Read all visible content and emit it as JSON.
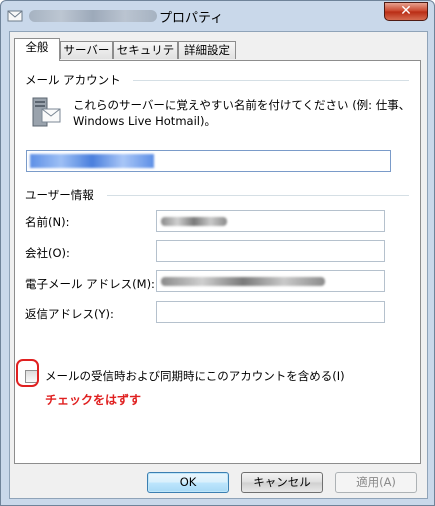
{
  "window": {
    "title": "プロパティ"
  },
  "tabs": [
    {
      "label": "全般",
      "active": true
    },
    {
      "label": "サーバー",
      "active": false
    },
    {
      "label": "セキュリティ",
      "active": false
    },
    {
      "label": "詳細設定",
      "active": false
    }
  ],
  "mail_account": {
    "group_title": "メール アカウント",
    "description_line1": "これらのサーバーに覚えやすい名前を付けてください (例: 仕事、",
    "description_line2": "Windows Live Hotmail)。"
  },
  "user_info": {
    "group_title": "ユーザー情報",
    "name_label": "名前(N):",
    "company_label": "会社(O):",
    "email_label": "電子メール アドレス(M):",
    "reply_label": "返信アドレス(Y):"
  },
  "include_checkbox": {
    "label": "メールの受信時および同期時にこのアカウントを含める(I)",
    "checked": false
  },
  "annotation": {
    "text": "チェックをはずす",
    "color": "#e02020"
  },
  "buttons": {
    "ok": "OK",
    "cancel": "キャンセル",
    "apply": "適用(A)"
  },
  "colors": {
    "window_frame": "#c9d8ea",
    "close_button": "#c9452c",
    "selection_highlight": "#5d8fe6"
  }
}
